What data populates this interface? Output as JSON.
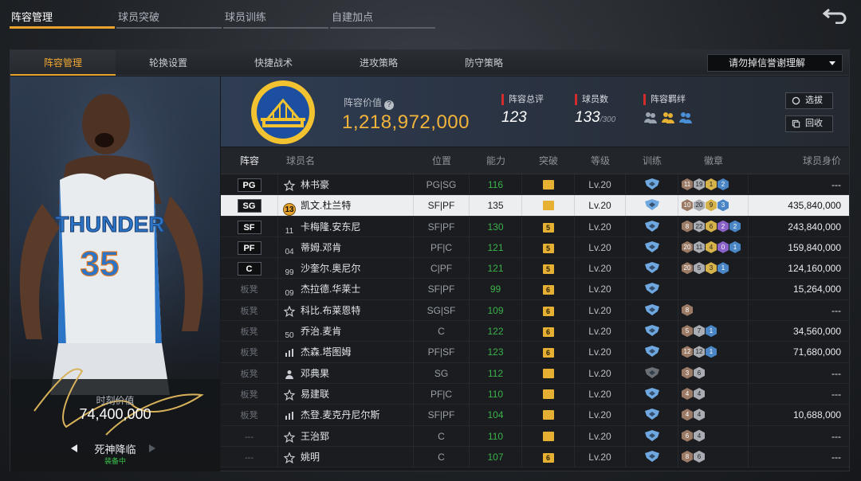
{
  "top_tabs": [
    "阵容管理",
    "球员突破",
    "球员训练",
    "自建加点"
  ],
  "sub_tabs": [
    "阵容管理",
    "轮换设置",
    "快捷战术",
    "进攻策略",
    "防守策略"
  ],
  "dropdown": {
    "value": "请勿掉信誉谢理解"
  },
  "player": {
    "moment_label": "时刻价值",
    "moment_value": "74,400,000",
    "skill_name": "死神降临",
    "skill_status": "装备中",
    "jersey_team": "THUNDER",
    "jersey_number": "35"
  },
  "lineup": {
    "value_label": "阵容价值",
    "value": "1,218,972,000",
    "rating_label": "阵容总评",
    "rating": "123",
    "count_label": "球员数",
    "count": "133",
    "count_max": "/300",
    "bond_label": "阵容羁绊",
    "select_btn": "选拔",
    "recycle_btn": "回收"
  },
  "colors": {
    "accent": "#e9a22b",
    "green": "#3bb24a",
    "red": "#d22c2c",
    "gold": "#f2b43b"
  },
  "table": {
    "headers": [
      "阵容",
      "球员名",
      "位置",
      "能力",
      "突破",
      "等级",
      "训练",
      "徽章",
      "球员身价"
    ],
    "rows": [
      {
        "slot": "PG",
        "icon": "star-icon",
        "name": "林书豪",
        "pos": "PG|SG",
        "ability": "116",
        "brk": "",
        "level": "Lv.20",
        "badges": [
          "11",
          "19",
          "1",
          "2"
        ],
        "bcol": [
          "br",
          "si",
          "go",
          "bl"
        ],
        "price": "---",
        "bench": false
      },
      {
        "slot": "SG",
        "icon": "number-13-icon",
        "name": "凯文.杜兰特",
        "pos": "SF|PF",
        "ability": "135",
        "brk": "",
        "level": "Lv.20",
        "badges": [
          "10",
          "20",
          "9",
          "3"
        ],
        "bcol": [
          "br",
          "si",
          "go",
          "bl"
        ],
        "price": "435,840,000",
        "bench": false,
        "selected": true
      },
      {
        "slot": "SF",
        "icon": "number-11-icon",
        "name": "卡梅隆.安东尼",
        "pos": "SF|PF",
        "ability": "130",
        "brk": "5",
        "level": "Lv.20",
        "badges": [
          "8",
          "22",
          "6",
          "2",
          "2"
        ],
        "bcol": [
          "br",
          "si",
          "go",
          "pu",
          "bl"
        ],
        "price": "243,840,000",
        "bench": false
      },
      {
        "slot": "PF",
        "icon": "number-04-icon",
        "name": "蒂姆.邓肯",
        "pos": "PF|C",
        "ability": "121",
        "brk": "5",
        "level": "Lv.20",
        "badges": [
          "20",
          "11",
          "4",
          "0",
          "1"
        ],
        "bcol": [
          "br",
          "si",
          "go",
          "pu",
          "bl"
        ],
        "price": "159,840,000",
        "bench": false
      },
      {
        "slot": "C",
        "icon": "number-99-icon",
        "name": "沙奎尔.奥尼尔",
        "pos": "C|PF",
        "ability": "121",
        "brk": "5",
        "level": "Lv.20",
        "badges": [
          "20",
          "5",
          "3",
          "1"
        ],
        "bcol": [
          "br",
          "si",
          "go",
          "bl"
        ],
        "price": "124,160,000",
        "bench": false
      },
      {
        "slot": "板凳",
        "icon": "number-09-icon",
        "name": "杰拉德.华莱士",
        "pos": "SF|PF",
        "ability": "99",
        "brk": "6",
        "level": "Lv.20",
        "badges": [],
        "bcol": [],
        "price": "15,264,000",
        "bench": true
      },
      {
        "slot": "板凳",
        "icon": "star-icon",
        "name": "科比.布莱恩特",
        "pos": "SG|SF",
        "ability": "109",
        "brk": "6",
        "level": "Lv.20",
        "badges": [
          "8"
        ],
        "bcol": [
          "br"
        ],
        "price": "---",
        "bench": true
      },
      {
        "slot": "板凳",
        "icon": "number-50-icon",
        "name": "乔治.麦肯",
        "pos": "C",
        "ability": "122",
        "brk": "6",
        "level": "Lv.20",
        "badges": [
          "5",
          "7",
          "1"
        ],
        "bcol": [
          "br",
          "si",
          "bl"
        ],
        "price": "34,560,000",
        "bench": true
      },
      {
        "slot": "板凳",
        "icon": "bars-icon",
        "name": "杰森.塔图姆",
        "pos": "PF|SF",
        "ability": "123",
        "brk": "6",
        "level": "Lv.20",
        "badges": [
          "12",
          "12",
          "1"
        ],
        "bcol": [
          "br",
          "si",
          "bl"
        ],
        "price": "71,680,000",
        "bench": true
      },
      {
        "slot": "板凳",
        "icon": "person-icon",
        "name": "邓典果",
        "pos": "SG",
        "ability": "112",
        "brk": "",
        "level": "Lv.20",
        "badges": [
          "3",
          "6"
        ],
        "bcol": [
          "br",
          "si"
        ],
        "price": "---",
        "bench": true,
        "train_dim": true
      },
      {
        "slot": "板凳",
        "icon": "star-icon",
        "name": "易建联",
        "pos": "PF|C",
        "ability": "110",
        "brk": "",
        "level": "Lv.20",
        "badges": [
          "4",
          "4"
        ],
        "bcol": [
          "br",
          "si"
        ],
        "price": "---",
        "bench": true
      },
      {
        "slot": "板凳",
        "icon": "bars-icon",
        "name": "杰登.麦克丹尼尔斯",
        "pos": "SF|PF",
        "ability": "104",
        "brk": "",
        "level": "Lv.20",
        "badges": [
          "4",
          "4"
        ],
        "bcol": [
          "br",
          "si"
        ],
        "price": "10,688,000",
        "bench": true
      },
      {
        "slot": "---",
        "icon": "star-icon",
        "name": "王治郅",
        "pos": "C",
        "ability": "110",
        "brk": "",
        "level": "Lv.20",
        "badges": [
          "6",
          "4"
        ],
        "bcol": [
          "br",
          "si"
        ],
        "price": "---",
        "bench": true
      },
      {
        "slot": "---",
        "icon": "star-icon",
        "name": "姚明",
        "pos": "C",
        "ability": "107",
        "brk": "6",
        "level": "Lv.20",
        "badges": [
          "8",
          "6"
        ],
        "bcol": [
          "br",
          "si"
        ],
        "price": "---",
        "bench": true
      }
    ]
  }
}
